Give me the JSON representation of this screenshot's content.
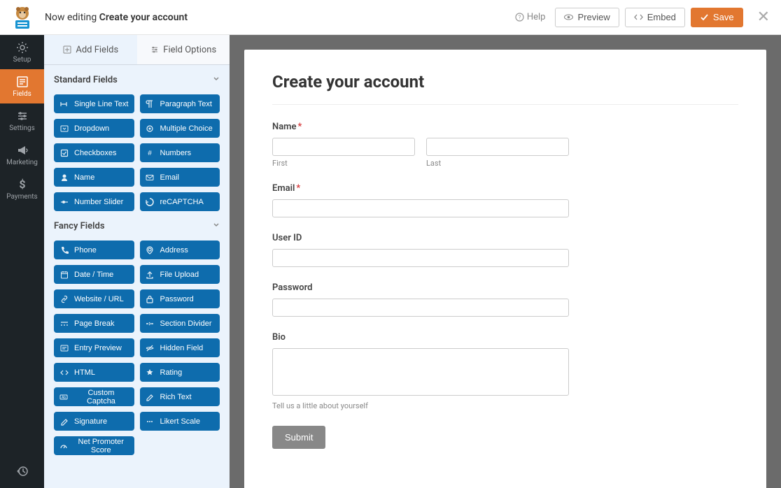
{
  "topbar": {
    "editing_prefix": "Now editing",
    "form_name": "Create your account",
    "help": "Help",
    "preview": "Preview",
    "embed": "Embed",
    "save": "Save"
  },
  "nav": {
    "setup": "Setup",
    "fields": "Fields",
    "settings": "Settings",
    "marketing": "Marketing",
    "payments": "Payments"
  },
  "tabs": {
    "add_fields": "Add Fields",
    "field_options": "Field Options"
  },
  "sections": {
    "standard": "Standard Fields",
    "fancy": "Fancy Fields"
  },
  "fields_standard": [
    "Single Line Text",
    "Paragraph Text",
    "Dropdown",
    "Multiple Choice",
    "Checkboxes",
    "Numbers",
    "Name",
    "Email",
    "Number Slider",
    "reCAPTCHA"
  ],
  "fields_fancy": [
    "Phone",
    "Address",
    "Date / Time",
    "File Upload",
    "Website / URL",
    "Password",
    "Page Break",
    "Section Divider",
    "Entry Preview",
    "Hidden Field",
    "HTML",
    "Rating",
    "Custom Captcha",
    "Rich Text",
    "Signature",
    "Likert Scale",
    "Net Promoter Score"
  ],
  "form": {
    "title": "Create your account",
    "name_label": "Name",
    "first": "First",
    "last": "Last",
    "email_label": "Email",
    "userid_label": "User ID",
    "password_label": "Password",
    "bio_label": "Bio",
    "bio_help": "Tell us a little about yourself",
    "submit": "Submit"
  }
}
